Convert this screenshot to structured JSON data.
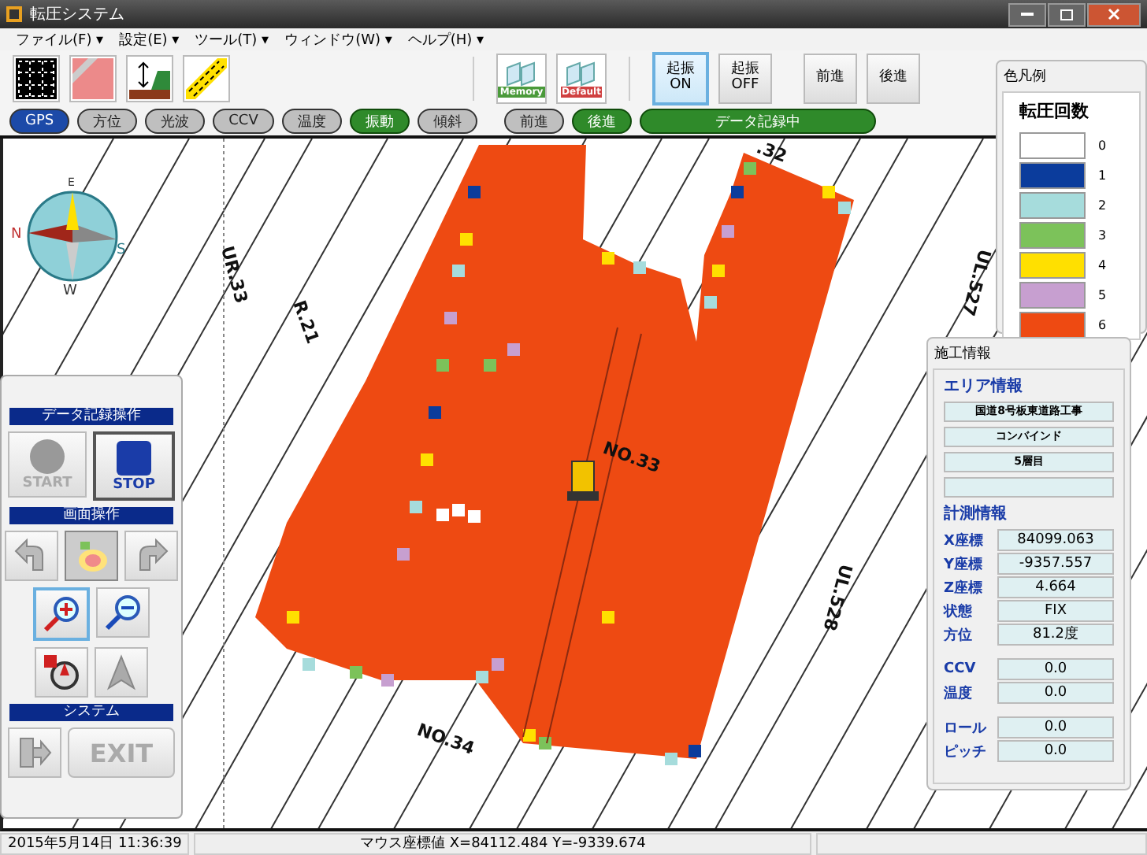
{
  "window": {
    "title": "転圧システム"
  },
  "menu": [
    "ファイル(F) ▾",
    "設定(E) ▾",
    "ツール(T) ▾",
    "ウィンドウ(W) ▾",
    "ヘルプ(H) ▾"
  ],
  "toolbar": {
    "memory_label": "Memory",
    "default_label": "Default",
    "buttons": [
      {
        "label": "起振\nON",
        "selected": true
      },
      {
        "label": "起振\nOFF",
        "selected": false
      },
      {
        "label": "前進",
        "selected": false
      },
      {
        "label": "後進",
        "selected": false
      }
    ]
  },
  "indicators": [
    {
      "label": "GPS",
      "selected": true,
      "on": false
    },
    {
      "label": "方位",
      "selected": false,
      "on": false
    },
    {
      "label": "光波",
      "selected": false,
      "on": false
    },
    {
      "label": "CCV",
      "selected": false,
      "on": false
    },
    {
      "label": "温度",
      "selected": false,
      "on": false
    },
    {
      "label": "振動",
      "selected": false,
      "on": true
    },
    {
      "label": "傾斜",
      "selected": false,
      "on": false
    },
    {
      "label": "前進",
      "selected": false,
      "on": false
    },
    {
      "label": "後進",
      "selected": false,
      "on": true
    },
    {
      "label": "データ記録中",
      "selected": false,
      "on": true
    }
  ],
  "compass": {
    "north": "N",
    "south": "S",
    "east": "E",
    "west": "W"
  },
  "map_labels": [
    "UR.33",
    "R.21",
    ".32",
    "UL.527",
    "NO.33",
    "UL.528",
    "NO.34"
  ],
  "legend": {
    "title": "色凡例",
    "heading": "転圧回数",
    "items": [
      {
        "label": "0",
        "color": "#ffffff"
      },
      {
        "label": "1",
        "color": "#0b3c9c"
      },
      {
        "label": "2",
        "color": "#a6dcdc"
      },
      {
        "label": "3",
        "color": "#7cc25a"
      },
      {
        "label": "4",
        "color": "#ffe000"
      },
      {
        "label": "5",
        "color": "#c79fd0"
      },
      {
        "label": "6",
        "color": "#ee4a12"
      }
    ]
  },
  "info": {
    "title": "施工情報",
    "area_heading": "エリア情報",
    "area_fields": [
      "国道8号板東道路工事",
      "コンバインド",
      "5層目"
    ],
    "measure_heading": "計測情報",
    "measure_groups": [
      [
        {
          "label": "X座標",
          "value": "84099.063"
        },
        {
          "label": "Y座標",
          "value": "-9357.557"
        },
        {
          "label": "Z座標",
          "value": "4.664"
        },
        {
          "label": "状態",
          "value": "FIX"
        },
        {
          "label": "方位",
          "value": "81.2度"
        }
      ],
      [
        {
          "label": "CCV",
          "value": "0.0"
        },
        {
          "label": "温度",
          "value": "0.0"
        }
      ],
      [
        {
          "label": "ロール",
          "value": "0.0"
        },
        {
          "label": "ピッチ",
          "value": "0.0"
        }
      ]
    ]
  },
  "control_panel": {
    "record_heading": "データ記録操作",
    "start": {
      "label": "START",
      "disabled": true
    },
    "stop": {
      "label": "STOP",
      "disabled": false
    },
    "view_heading": "画面操作",
    "zoom_in_selected": true,
    "system_heading": "システム",
    "exit": {
      "label": "EXIT",
      "disabled": true
    }
  },
  "status_bar": {
    "datetime": "2015年5月14日 11:36:39",
    "mouse": "マウス座標値 X=84112.484 Y=-9339.674"
  }
}
